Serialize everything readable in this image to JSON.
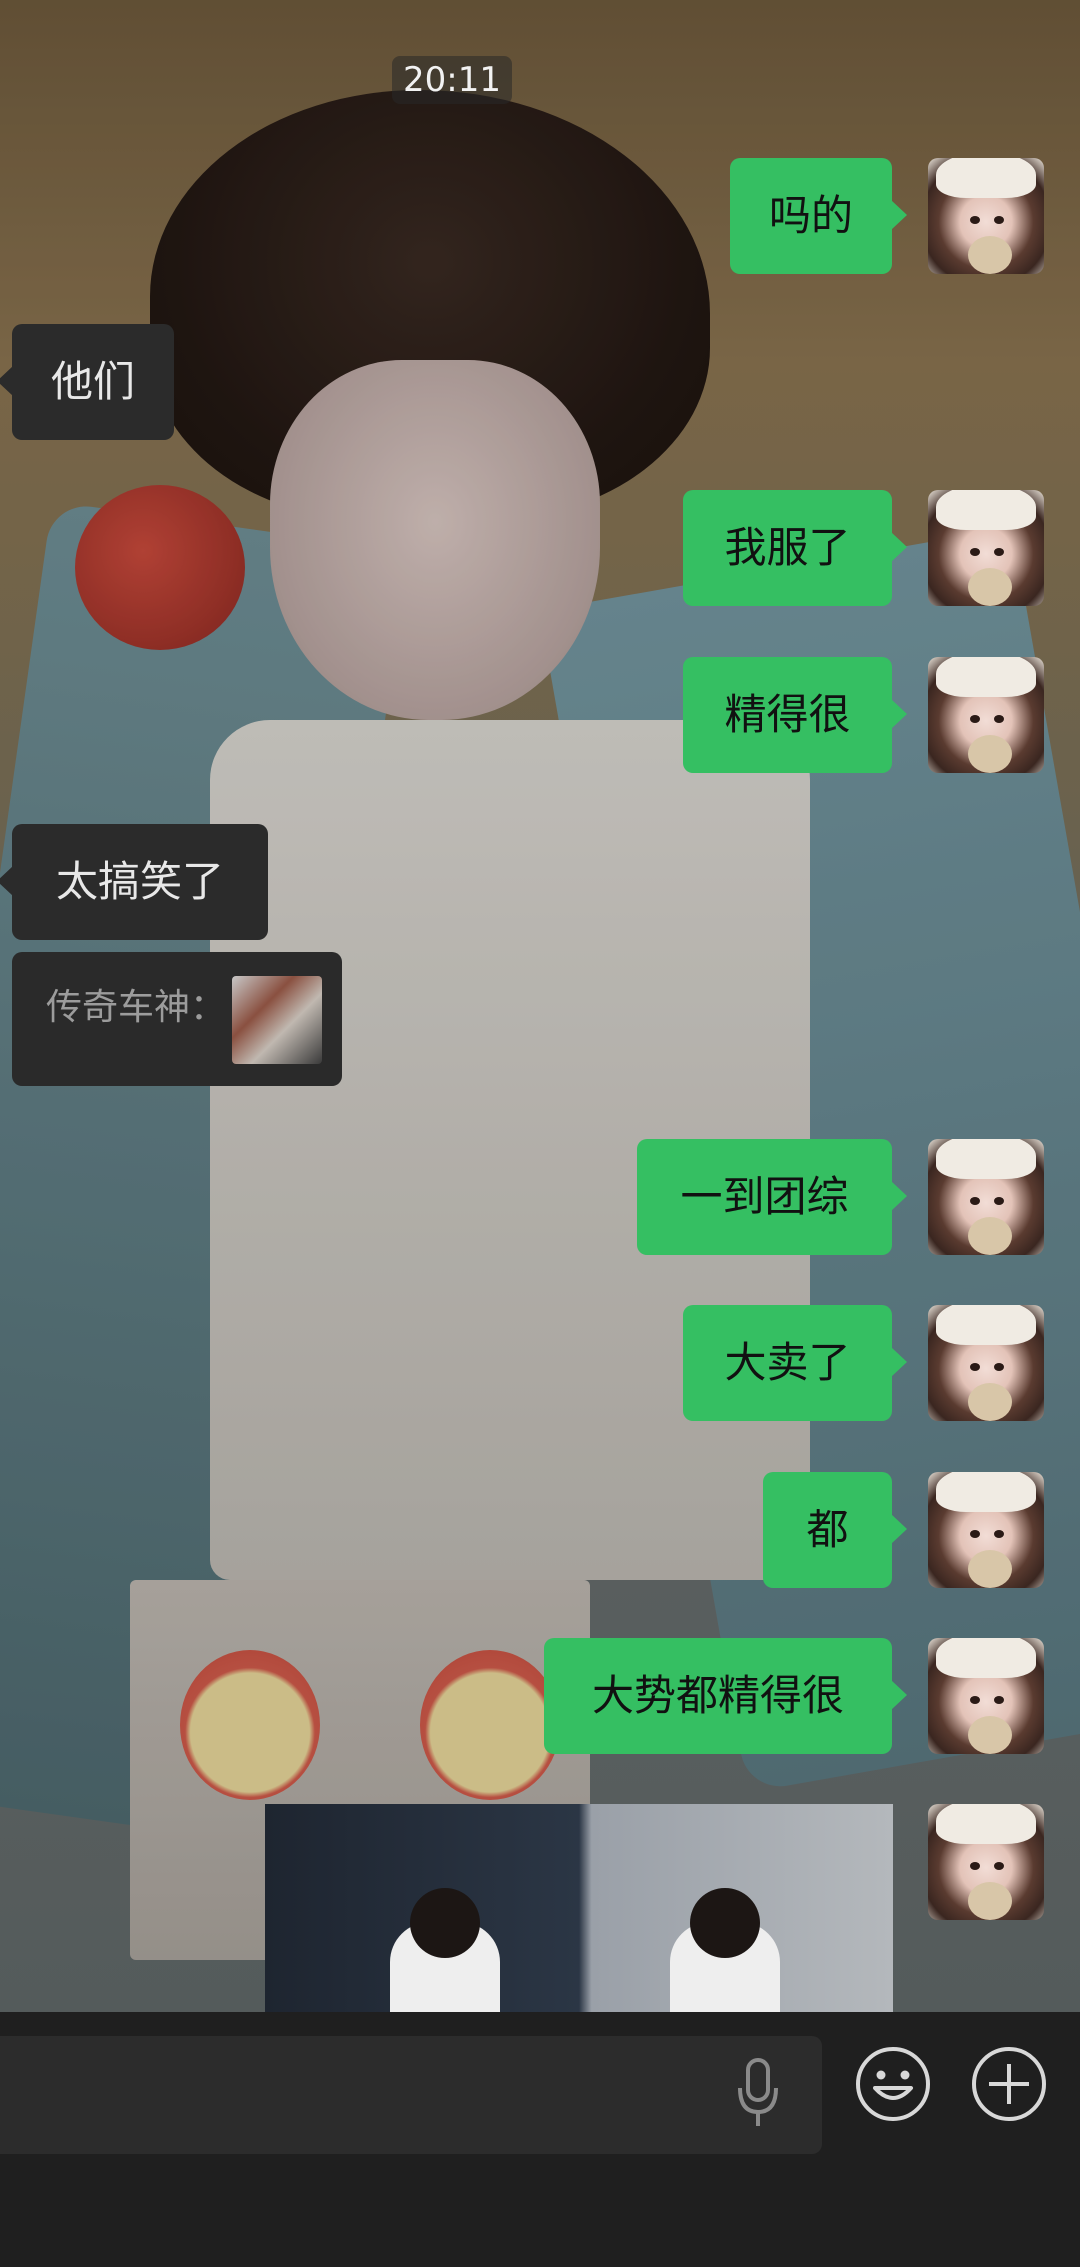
{
  "status": {
    "time": "20:11"
  },
  "messages": {
    "m1": {
      "text": "吗的"
    },
    "m2": {
      "text": "他们"
    },
    "m3": {
      "text": "我服了"
    },
    "m4": {
      "text": "精得很"
    },
    "m5": {
      "text": "太搞笑了"
    },
    "m6": {
      "quote_text": "传奇车神："
    },
    "m7": {
      "text": "一到团综"
    },
    "m8": {
      "text": "大卖了"
    },
    "m9": {
      "text": "都"
    },
    "m10": {
      "text": "大势都精得很"
    }
  },
  "colors": {
    "outgoing_bubble": "#35bf62",
    "incoming_bubble": "#2b2b2b",
    "input_bar": "#1f1f1f"
  },
  "input_bar": {
    "icons": [
      "microphone-icon",
      "emoji-icon",
      "plus-icon"
    ]
  }
}
